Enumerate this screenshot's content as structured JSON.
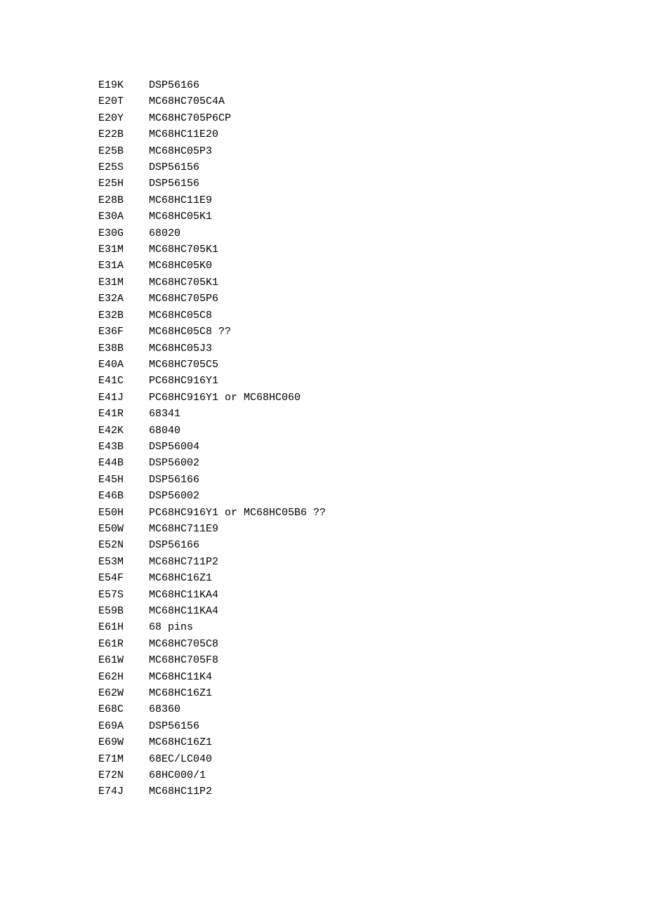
{
  "rows": [
    {
      "code": "E19K",
      "part": "DSP56166"
    },
    {
      "code": "E20T",
      "part": "MC68HC705C4A"
    },
    {
      "code": "E20Y",
      "part": "MC68HC705P6CP"
    },
    {
      "code": "E22B",
      "part": "MC68HC11E20"
    },
    {
      "code": "E25B",
      "part": "MC68HC05P3"
    },
    {
      "code": "E25S",
      "part": "DSP56156"
    },
    {
      "code": "E25H",
      "part": "DSP56156"
    },
    {
      "code": "E28B",
      "part": "MC68HC11E9"
    },
    {
      "code": "E30A",
      "part": "MC68HC05K1"
    },
    {
      "code": "E30G",
      "part": "68020"
    },
    {
      "code": "E31M",
      "part": "MC68HC705K1"
    },
    {
      "code": "E31A",
      "part": "MC68HC05K0"
    },
    {
      "code": "E31M",
      "part": "MC68HC705K1"
    },
    {
      "code": "E32A",
      "part": "MC68HC705P6"
    },
    {
      "code": "E32B",
      "part": "MC68HC05C8"
    },
    {
      "code": "E36F",
      "part": "MC68HC05C8 ??"
    },
    {
      "code": "E38B",
      "part": "MC68HC05J3"
    },
    {
      "code": "E40A",
      "part": "MC68HC705C5"
    },
    {
      "code": "E41C",
      "part": "PC68HC916Y1"
    },
    {
      "code": "E41J",
      "part": "PC68HC916Y1 or MC68HC060"
    },
    {
      "code": "E41R",
      "part": "68341"
    },
    {
      "code": "E42K",
      "part": "68040"
    },
    {
      "code": "E43B",
      "part": "DSP56004"
    },
    {
      "code": "E44B",
      "part": "DSP56002"
    },
    {
      "code": "E45H",
      "part": "DSP56166"
    },
    {
      "code": "E46B",
      "part": "DSP56002"
    },
    {
      "code": "E50H",
      "part": "PC68HC916Y1 or MC68HC05B6 ??"
    },
    {
      "code": "E50W",
      "part": "MC68HC711E9"
    },
    {
      "code": "E52N",
      "part": "DSP56166"
    },
    {
      "code": "E53M",
      "part": "MC68HC711P2"
    },
    {
      "code": "E54F",
      "part": "MC68HC16Z1"
    },
    {
      "code": "E57S",
      "part": "MC68HC11KA4"
    },
    {
      "code": "E59B",
      "part": "MC68HC11KA4"
    },
    {
      "code": "E61H",
      "part": "68 pins"
    },
    {
      "code": "E61R",
      "part": "MC68HC705C8"
    },
    {
      "code": "E61W",
      "part": "MC68HC705F8"
    },
    {
      "code": "E62H",
      "part": "MC68HC11K4"
    },
    {
      "code": "E62W",
      "part": "MC68HC16Z1"
    },
    {
      "code": "E68C",
      "part": "68360"
    },
    {
      "code": "E69A",
      "part": "DSP56156"
    },
    {
      "code": "E69W",
      "part": "MC68HC16Z1"
    },
    {
      "code": "E71M",
      "part": "68EC/LC040"
    },
    {
      "code": "E72N",
      "part": "68HC000/1"
    },
    {
      "code": "E74J",
      "part": "MC68HC11P2"
    }
  ]
}
